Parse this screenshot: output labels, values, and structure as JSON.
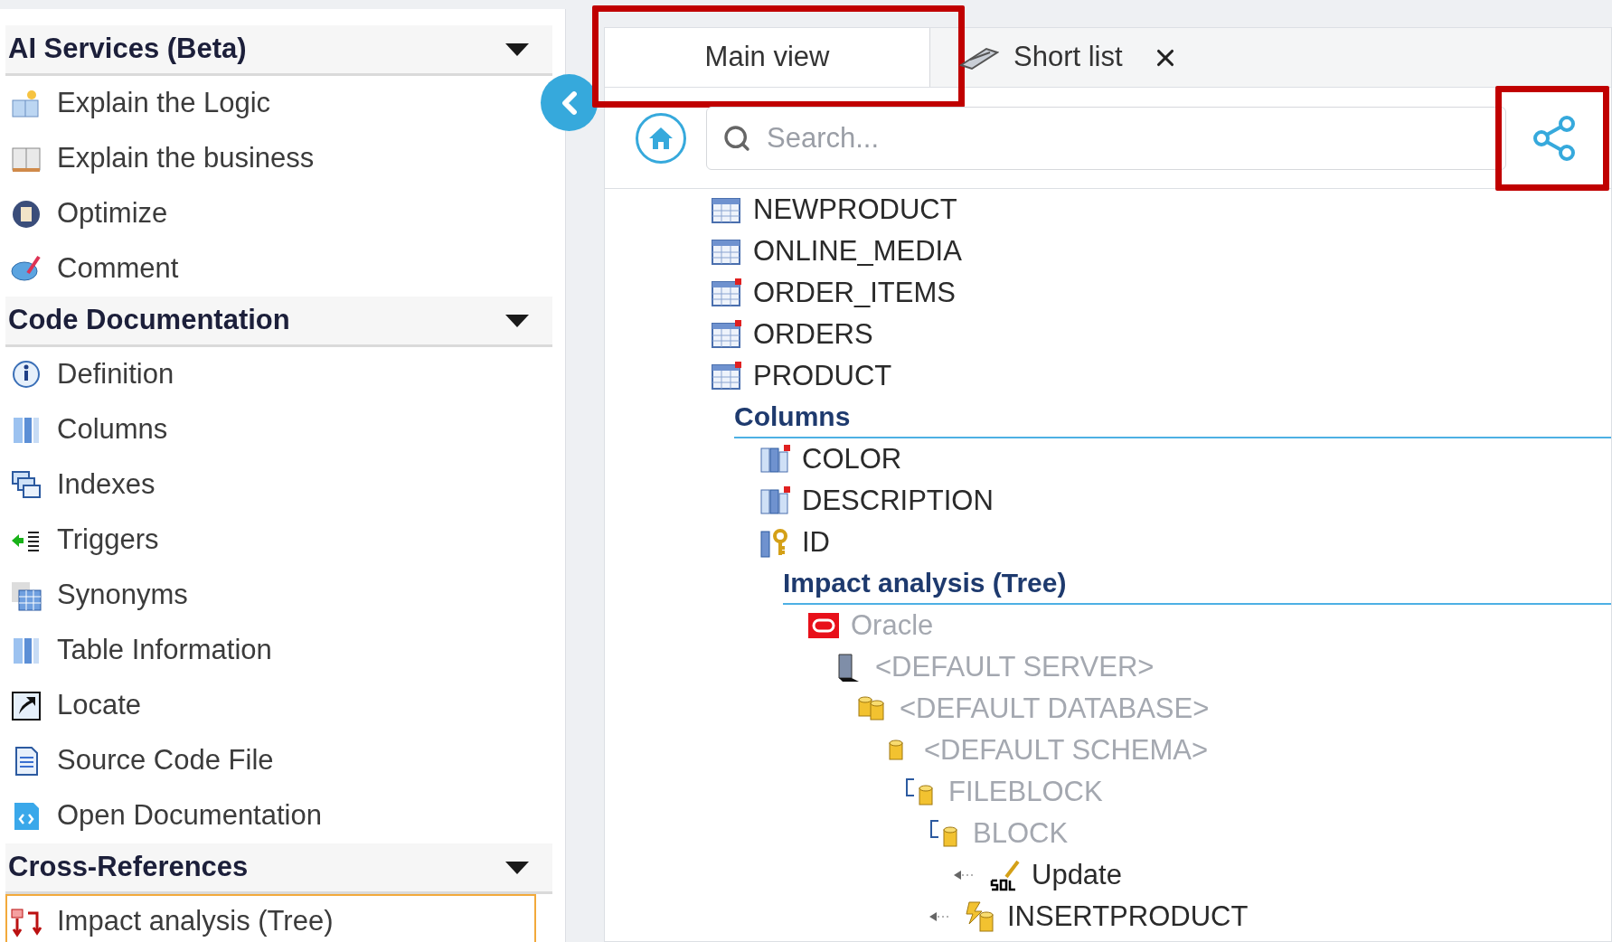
{
  "sidebar": {
    "sections": [
      {
        "title": "AI Services (Beta)",
        "expanded": true,
        "items": [
          {
            "label": "Explain the Logic",
            "selected": false
          },
          {
            "label": "Explain the business",
            "selected": false
          },
          {
            "label": "Optimize",
            "selected": false
          },
          {
            "label": "Comment",
            "selected": false
          }
        ]
      },
      {
        "title": "Code Documentation",
        "expanded": true,
        "items": [
          {
            "label": "Definition",
            "selected": false
          },
          {
            "label": "Columns",
            "selected": false
          },
          {
            "label": "Indexes",
            "selected": false
          },
          {
            "label": "Triggers",
            "selected": false
          },
          {
            "label": "Synonyms",
            "selected": false
          },
          {
            "label": "Table Information",
            "selected": false
          },
          {
            "label": "Locate",
            "selected": false
          },
          {
            "label": "Source Code File",
            "selected": false
          },
          {
            "label": "Open Documentation",
            "selected": false
          }
        ]
      },
      {
        "title": "Cross-References",
        "expanded": true,
        "items": [
          {
            "label": "Impact analysis (Tree)",
            "selected": true
          }
        ]
      }
    ]
  },
  "tabs": [
    {
      "label": "Main view",
      "selected": true,
      "closable": false,
      "highlighted": true
    },
    {
      "label": "Short list",
      "selected": false,
      "closable": true,
      "highlighted": false
    }
  ],
  "search": {
    "placeholder": "Search..."
  },
  "share_button": {
    "highlighted": true
  },
  "tree": [
    {
      "label": "NEWPRODUCT",
      "kind": "table",
      "flagged": false,
      "dimmed": false
    },
    {
      "label": "ONLINE_MEDIA",
      "kind": "table",
      "flagged": false,
      "dimmed": false
    },
    {
      "label": "ORDER_ITEMS",
      "kind": "table",
      "flagged": true,
      "dimmed": false
    },
    {
      "label": "ORDERS",
      "kind": "table",
      "flagged": true,
      "dimmed": false
    },
    {
      "label": "PRODUCT",
      "kind": "table",
      "flagged": true,
      "dimmed": false,
      "children": [
        {
          "label": "Columns",
          "kind": "section",
          "children": [
            {
              "label": "COLOR",
              "kind": "column",
              "flagged": true,
              "dimmed": false
            },
            {
              "label": "DESCRIPTION",
              "kind": "column",
              "flagged": true,
              "dimmed": false
            },
            {
              "label": "ID",
              "kind": "key",
              "flagged": false,
              "dimmed": false,
              "children": [
                {
                  "label": "Impact analysis (Tree)",
                  "kind": "section",
                  "children": [
                    {
                      "label": "Oracle",
                      "kind": "oracle",
                      "dimmed": true,
                      "children": [
                        {
                          "label": "<DEFAULT SERVER>",
                          "kind": "server",
                          "dimmed": true,
                          "children": [
                            {
                              "label": "<DEFAULT DATABASE>",
                              "kind": "database",
                              "dimmed": true,
                              "children": [
                                {
                                  "label": "<DEFAULT SCHEMA>",
                                  "kind": "schema",
                                  "dimmed": true,
                                  "children": [
                                    {
                                      "label": "FILEBLOCK",
                                      "kind": "block",
                                      "dimmed": true,
                                      "children": [
                                        {
                                          "label": "BLOCK",
                                          "kind": "block",
                                          "dimmed": true,
                                          "children": [
                                            {
                                              "label": "Update",
                                              "kind": "sql",
                                              "dimmed": false
                                            }
                                          ]
                                        },
                                        {
                                          "label": "INSERTPRODUCT",
                                          "kind": "procedure",
                                          "dimmed": false
                                        }
                                      ]
                                    }
                                  ]
                                }
                              ]
                            }
                          ]
                        }
                      ]
                    }
                  ]
                }
              ]
            }
          ]
        }
      ]
    }
  ]
}
